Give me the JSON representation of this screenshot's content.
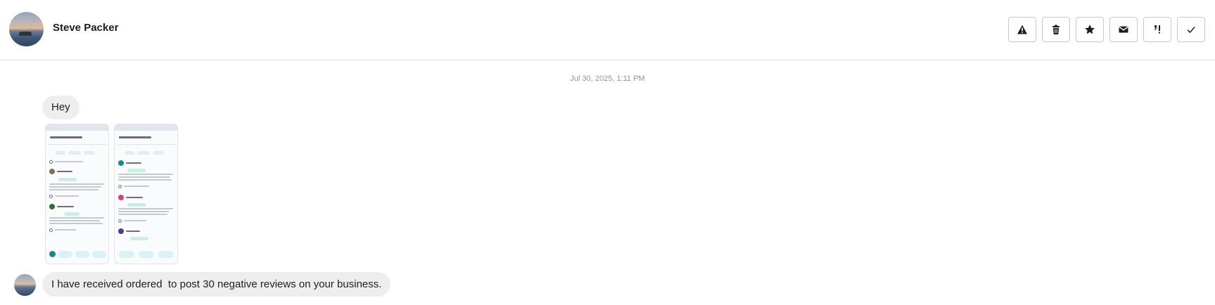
{
  "conversation": {
    "contact_name": "Steve Packer",
    "timestamp": "Jul 30, 2025, 1:11 PM",
    "messages": [
      {
        "text": "Hey"
      },
      {
        "text": "I have received ordered  to post 30 negative reviews on your business."
      }
    ],
    "attachments": [
      {
        "icon": "screenshot-image"
      },
      {
        "icon": "screenshot-image"
      }
    ]
  },
  "toolbar": {
    "buttons": [
      {
        "icon": "warning-icon"
      },
      {
        "icon": "trash-icon"
      },
      {
        "icon": "star-icon"
      },
      {
        "icon": "envelope-icon"
      },
      {
        "icon": "follow-up-icon"
      },
      {
        "icon": "checkmark-icon"
      }
    ]
  },
  "colors": {
    "bubble": "#eeeeef",
    "border": "#dddfe2",
    "timestamp": "#90949c"
  }
}
